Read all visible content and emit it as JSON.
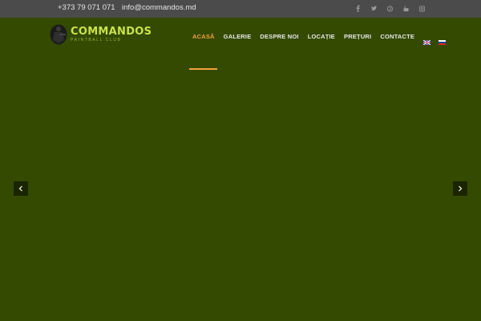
{
  "topbar": {
    "phone": "+373 79 071 071",
    "email": "info@commandos.md",
    "social": [
      "facebook-icon",
      "twitter-icon",
      "pinterest-icon",
      "youtube-icon",
      "instagram-icon"
    ]
  },
  "logo": {
    "brand": "COMMANDOS",
    "tagline": "PAINTBALL CLUB"
  },
  "nav": {
    "items": [
      "ACASĂ",
      "GALERIE",
      "DESPRE NOI",
      "LOCAȚIE",
      "PREȚURI",
      "CONTACTE"
    ],
    "active_index": 0,
    "languages": [
      "english-flag-icon",
      "russian-flag-icon"
    ]
  },
  "colors": {
    "accent": "#f2a23a",
    "background": "#344a00",
    "topbar": "#4b4b4b",
    "brand": "#c9e24a"
  },
  "slider": {
    "prev_icon": "chevron-left-icon",
    "next_icon": "chevron-right-icon"
  }
}
